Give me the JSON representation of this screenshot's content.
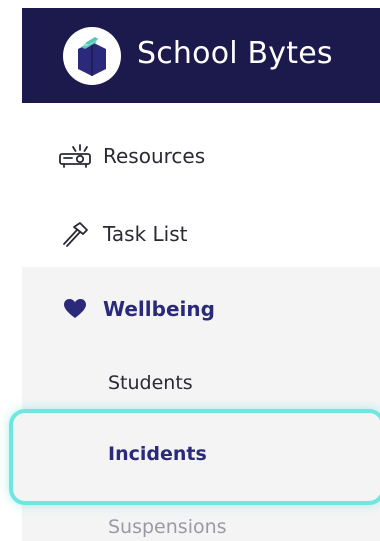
{
  "brand": {
    "name": "School Bytes",
    "colors": {
      "header_bg": "#1c1a4d",
      "logo_book": "#2b2a7a",
      "logo_pages": "#57c7b4"
    }
  },
  "nav": {
    "items": [
      {
        "label": "Resources",
        "icon": "projector-icon"
      },
      {
        "label": "Task List",
        "icon": "hammer-icon"
      },
      {
        "label": "Wellbeing",
        "icon": "heart-icon",
        "expanded": true,
        "children": [
          {
            "label": "Students"
          },
          {
            "label": "Incidents",
            "selected": true
          },
          {
            "label": "Suspensions"
          }
        ]
      }
    ],
    "colors": {
      "active": "#2b2a7a",
      "highlight_ring": "#6fe6e0"
    }
  }
}
